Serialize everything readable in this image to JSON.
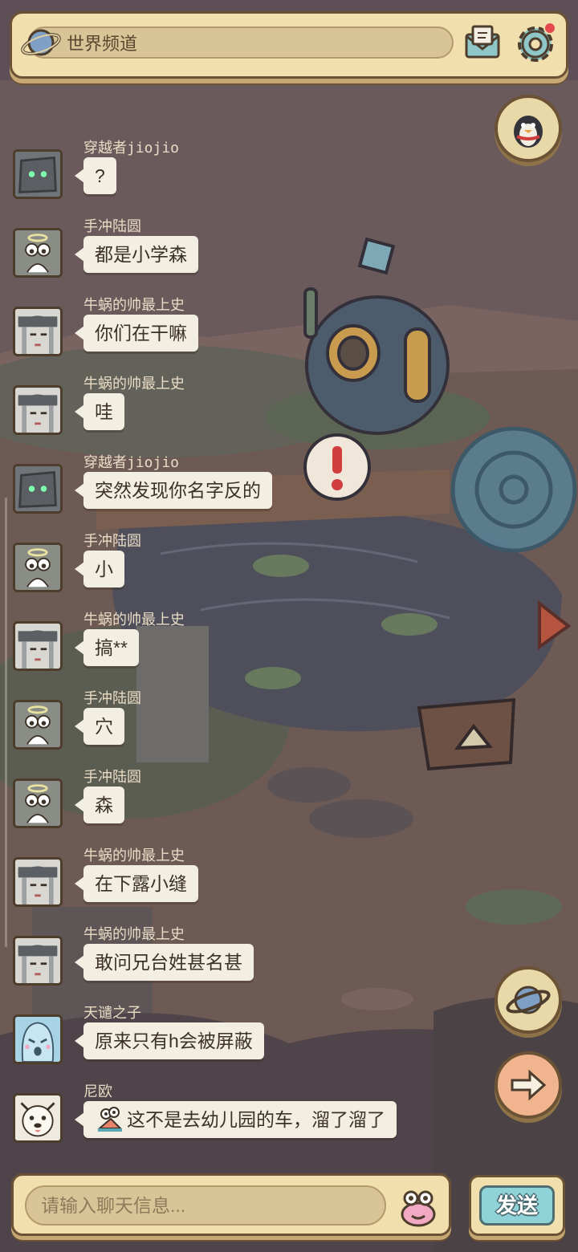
{
  "header": {
    "channel_label": "世界频道",
    "icons": [
      "planet-icon",
      "mail-icon",
      "gear-icon"
    ],
    "has_notification_dot": true
  },
  "side_buttons": [
    "penguin-icon",
    "planet-icon",
    "arrow-right-icon",
    "triangle-arrow-icon"
  ],
  "messages": [
    {
      "username": "",
      "text": "",
      "avatar": "ghost-girl",
      "partial": true
    },
    {
      "username": "穿越者jiojio",
      "text": "?",
      "avatar": "robot"
    },
    {
      "username": "手冲陆圆",
      "text": "都是小学森",
      "avatar": "snail"
    },
    {
      "username": "牛蜗的帅最上史",
      "text": "你们在干嘛",
      "avatar": "ghost-girl"
    },
    {
      "username": "牛蜗的帅最上史",
      "text": "哇",
      "avatar": "ghost-girl"
    },
    {
      "username": "穿越者jiojio",
      "text": "突然发现你名字反的",
      "avatar": "robot"
    },
    {
      "username": "手冲陆圆",
      "text": "小",
      "avatar": "snail"
    },
    {
      "username": "牛蜗的帅最上史",
      "text": "搞**",
      "avatar": "ghost-girl"
    },
    {
      "username": "手冲陆圆",
      "text": "穴",
      "avatar": "snail"
    },
    {
      "username": "手冲陆圆",
      "text": "森",
      "avatar": "snail"
    },
    {
      "username": "牛蜗的帅最上史",
      "text": "在下露小缝",
      "avatar": "ghost-girl"
    },
    {
      "username": "牛蜗的帅最上史",
      "text": "敢问兄台姓甚名甚",
      "avatar": "ghost-girl"
    },
    {
      "username": "天谴之子",
      "text": "原来只有h会被屏蔽",
      "avatar": "blue-ghost"
    },
    {
      "username": "尼欧",
      "text": "这不是去幼儿园的车，溜了溜了",
      "avatar": "dog",
      "emoji": "snail-emoji-icon"
    }
  ],
  "input": {
    "placeholder": "请输入聊天信息..."
  },
  "send_label": "发送",
  "colors": {
    "panel": "#f2dfae",
    "panel_border": "#6b5235",
    "bubble": "#f3eee2",
    "send_button": "#8fd3d8",
    "notification_dot": "#e5484d"
  }
}
